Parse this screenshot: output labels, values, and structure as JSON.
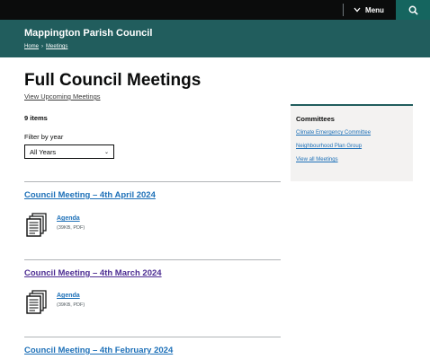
{
  "topbar": {
    "menu_label": "Menu",
    "menu_icon": "chevron-down-icon",
    "search_icon": "search-icon",
    "search_bg": "#15655f"
  },
  "header": {
    "site_title": "Mappington Parish Council",
    "breadcrumb": [
      {
        "label": "Home"
      },
      {
        "label": "Meetings"
      }
    ],
    "separator": "›",
    "bg_color": "#215d5d"
  },
  "main": {
    "title": "Full Council Meetings",
    "upcoming_link": "View Upcoming Meetings",
    "item_count": "9 items",
    "filter_label": "Filter by year",
    "filter_selected": "All Years"
  },
  "sidebar": {
    "heading": "Committees",
    "links": [
      {
        "label": "Climate Emergency Committee"
      },
      {
        "label": "Neighbourhood Plan Group"
      },
      {
        "label": "View all Meetings"
      }
    ]
  },
  "meetings": [
    {
      "title": "Council Meeting – 4th April 2024",
      "title_color": "#1d70b8",
      "doc_label": "Agenda",
      "doc_meta": "(39KB, PDF)"
    },
    {
      "title": "Council Meeting – 4th March 2024",
      "title_color": "#4c2c92",
      "doc_label": "Agenda",
      "doc_meta": "(39KB, PDF)"
    },
    {
      "title": "Council Meeting – 4th February 2024",
      "title_color": "#1d70b8"
    }
  ]
}
